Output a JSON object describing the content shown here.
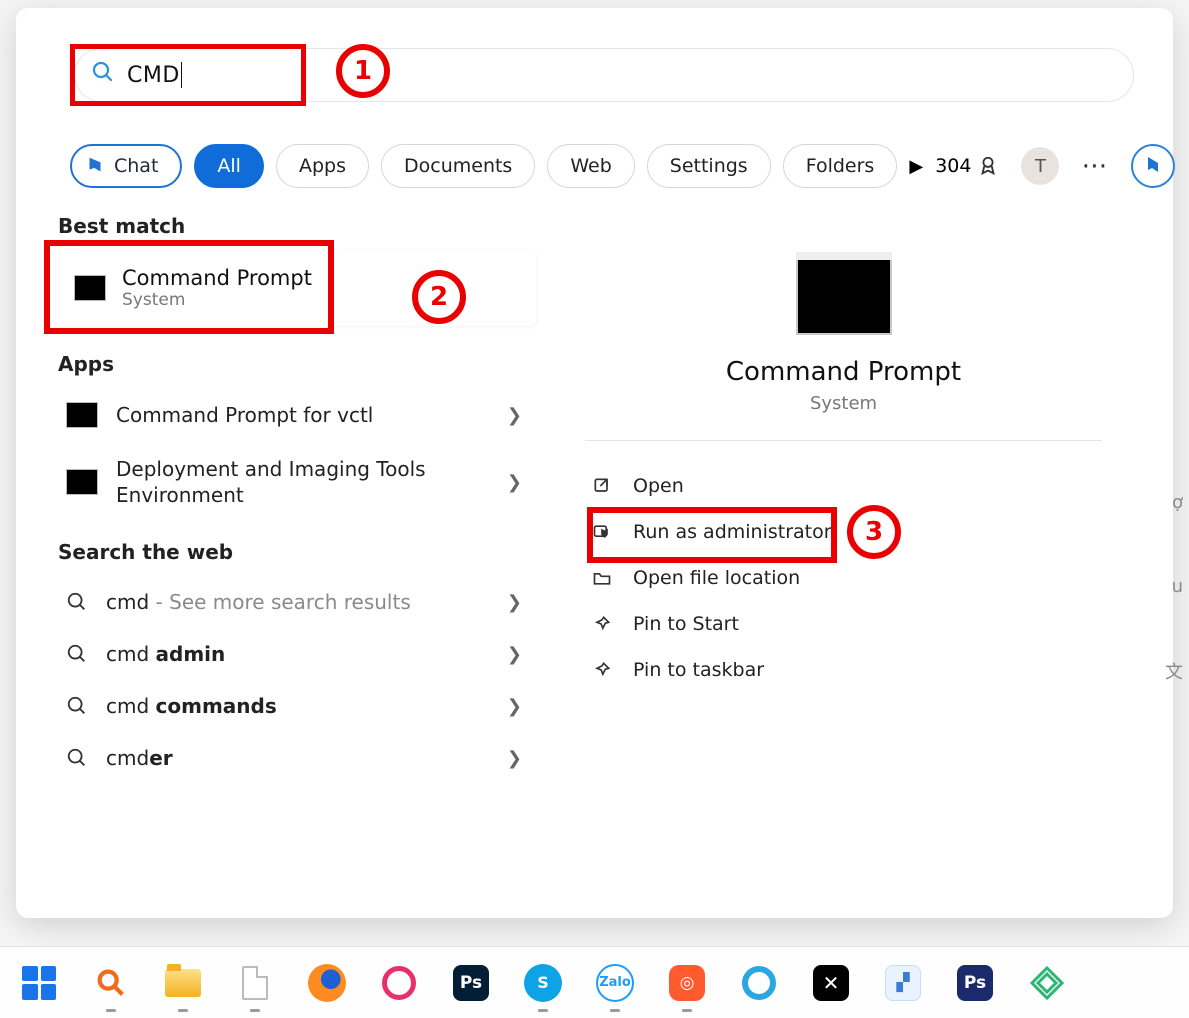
{
  "search": {
    "query": "CMD"
  },
  "chips": {
    "chat": "Chat",
    "all": "All",
    "apps": "Apps",
    "documents": "Documents",
    "web": "Web",
    "settings": "Settings",
    "folders": "Folders"
  },
  "header": {
    "points": "304",
    "avatar_letter": "T"
  },
  "steps": {
    "one": "1",
    "two": "2",
    "three": "3"
  },
  "left": {
    "best_match_heading": "Best match",
    "best_match": {
      "title": "Command Prompt",
      "subtitle": "System"
    },
    "apps_heading": "Apps",
    "apps": [
      {
        "label": "Command Prompt for vctl"
      },
      {
        "label": "Deployment and Imaging Tools Environment"
      }
    ],
    "web_heading": "Search the web",
    "web": [
      {
        "prefix": "cmd",
        "bold": "",
        "suffix": " - See more search results"
      },
      {
        "prefix": "cmd ",
        "bold": "admin",
        "suffix": ""
      },
      {
        "prefix": "cmd ",
        "bold": "commands",
        "suffix": ""
      },
      {
        "prefix": "cmd",
        "bold": "er",
        "suffix": ""
      }
    ]
  },
  "detail": {
    "title": "Command Prompt",
    "subtitle": "System",
    "actions": {
      "open": "Open",
      "run_admin": "Run as administrator",
      "open_loc": "Open file location",
      "pin_start": "Pin to Start",
      "pin_taskbar": "Pin to taskbar"
    }
  },
  "edge_hints": {
    "a": "ợ",
    "b": "u",
    "c": "文"
  }
}
